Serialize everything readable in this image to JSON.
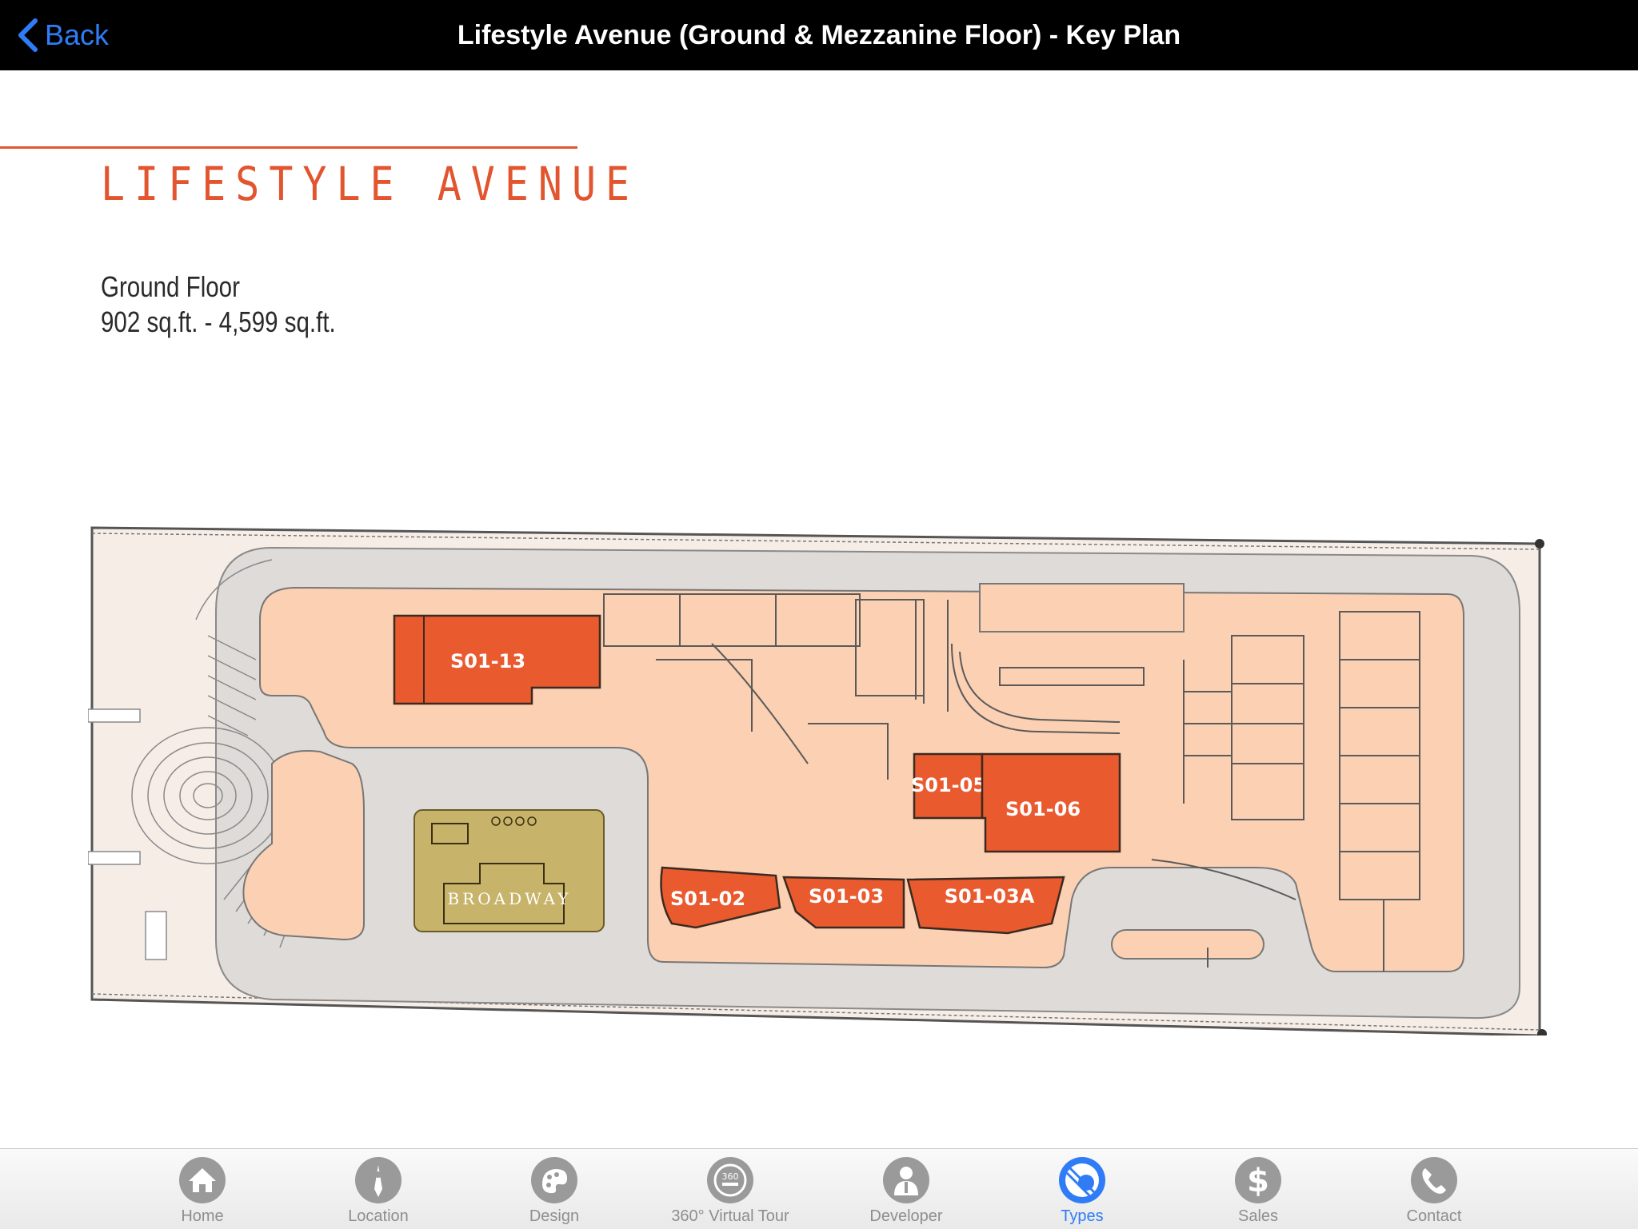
{
  "navbar": {
    "back_label": "Back",
    "title": "Lifestyle Avenue (Ground & Mezzanine Floor) - Key Plan"
  },
  "heading": {
    "brand": "LIFESTYLE AVENUE",
    "floor_name": "Ground Floor",
    "floor_size": "902 sq.ft. - 4,599 sq.ft."
  },
  "plan": {
    "units": {
      "s01_13": "S01-13",
      "s01_05": "S01-05",
      "s01_06": "S01-06",
      "s01_02": "S01-02",
      "s01_03": "S01-03",
      "s01_03a": "S01-03A"
    },
    "broadway_label": "BROADWAY",
    "colors": {
      "highlight_unit": "#ea5a2f",
      "building": "#fbd0b3",
      "road": "#dedbd8",
      "outer_ground": "#f6ede7",
      "broadway": "#c8b36a"
    }
  },
  "tabs": [
    {
      "label": "Home",
      "icon": "home-icon"
    },
    {
      "label": "Location",
      "icon": "location-icon"
    },
    {
      "label": "Design",
      "icon": "design-icon"
    },
    {
      "label": "360° Virtual Tour",
      "icon": "virtual-tour-icon"
    },
    {
      "label": "Developer",
      "icon": "developer-icon"
    },
    {
      "label": "Types",
      "icon": "types-icon",
      "active": true
    },
    {
      "label": "Sales",
      "icon": "sales-icon"
    },
    {
      "label": "Contact",
      "icon": "contact-icon"
    }
  ],
  "theme": {
    "accent": "#2f7cf6",
    "brand": "#e2552f"
  }
}
